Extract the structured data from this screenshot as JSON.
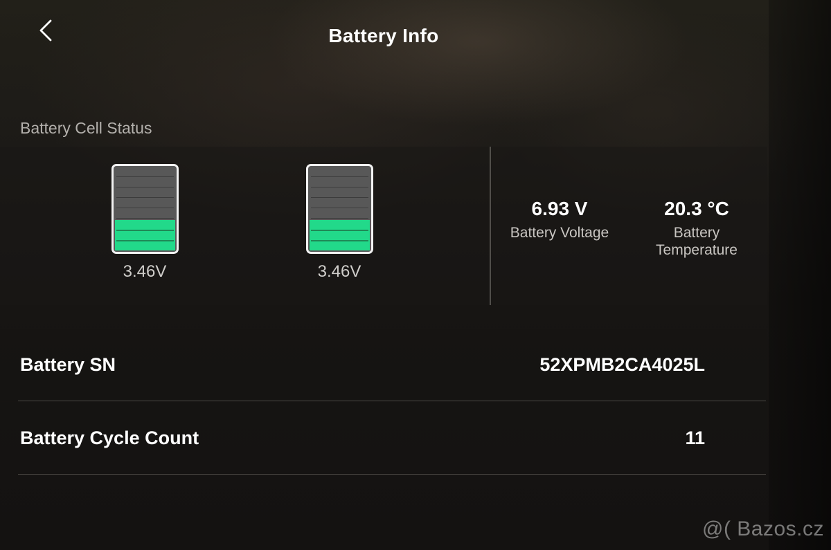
{
  "header": {
    "title": "Battery Info",
    "back_icon": "chevron-left-icon"
  },
  "cell_status": {
    "label": "Battery Cell Status",
    "cells": [
      {
        "voltage": "3.46V",
        "level_fraction": 0.4
      },
      {
        "voltage": "3.46V",
        "level_fraction": 0.4
      }
    ]
  },
  "stats": {
    "voltage": {
      "value": "6.93 V",
      "label": "Battery Voltage"
    },
    "temperature": {
      "value": "20.3 °C",
      "label": "Battery Temperature"
    }
  },
  "rows": [
    {
      "label": "Battery SN",
      "value": "52XPMB2CA4025L"
    },
    {
      "label": "Battery Cycle Count",
      "value": "11"
    }
  ],
  "watermark": "@( Bazos.cz",
  "colors": {
    "cell_fill": "#22d98a",
    "cell_empty": "#585858",
    "text_secondary": "#b3b0ac"
  }
}
